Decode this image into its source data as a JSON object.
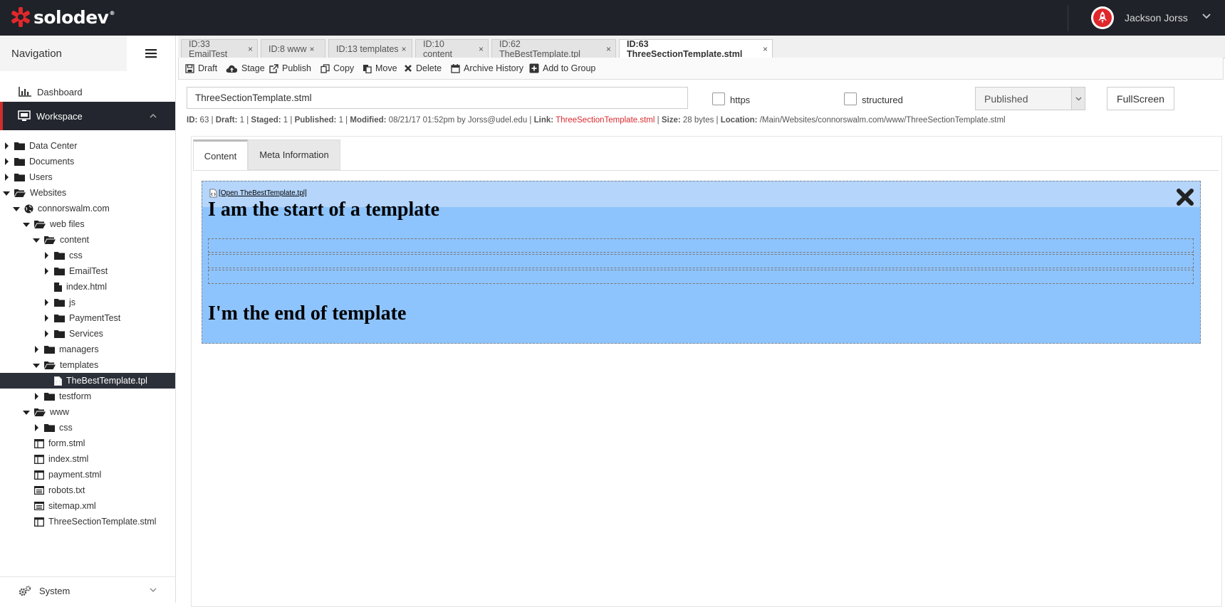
{
  "app": {
    "brand": "solodev",
    "brand_color": "#e0282c"
  },
  "user": {
    "name": "Jackson Jorss"
  },
  "sidebar": {
    "title": "Navigation",
    "dashboard": "Dashboard",
    "workspace": "Workspace",
    "system": "System",
    "tree": [
      {
        "label": "Data Center",
        "type": "folder",
        "expanded": false
      },
      {
        "label": "Documents",
        "type": "folder",
        "expanded": false
      },
      {
        "label": "Users",
        "type": "folder",
        "expanded": false
      },
      {
        "label": "Websites",
        "type": "folder",
        "expanded": true
      },
      {
        "label": "connorswalm.com",
        "type": "globe",
        "expanded": true
      },
      {
        "label": "web files",
        "type": "folder",
        "expanded": true
      },
      {
        "label": "content",
        "type": "folder",
        "expanded": true
      },
      {
        "label": "css",
        "type": "folder",
        "expanded": false
      },
      {
        "label": "EmailTest",
        "type": "folder",
        "expanded": false
      },
      {
        "label": "index.html",
        "type": "file"
      },
      {
        "label": "js",
        "type": "folder",
        "expanded": false
      },
      {
        "label": "PaymentTest",
        "type": "folder",
        "expanded": false
      },
      {
        "label": "Services",
        "type": "folder",
        "expanded": false
      },
      {
        "label": "managers",
        "type": "folder",
        "expanded": false
      },
      {
        "label": "templates",
        "type": "folder",
        "expanded": true
      },
      {
        "label": "TheBestTemplate.tpl",
        "type": "template",
        "selected": true
      },
      {
        "label": "testform",
        "type": "folder",
        "expanded": false
      },
      {
        "label": "www",
        "type": "folder",
        "expanded": true
      },
      {
        "label": "css",
        "type": "folder",
        "expanded": false
      },
      {
        "label": "form.stml",
        "type": "stml"
      },
      {
        "label": "index.stml",
        "type": "stml"
      },
      {
        "label": "payment.stml",
        "type": "stml"
      },
      {
        "label": "robots.txt",
        "type": "text"
      },
      {
        "label": "sitemap.xml",
        "type": "text"
      },
      {
        "label": "ThreeSectionTemplate.stml",
        "type": "stml"
      }
    ]
  },
  "file_tabs": [
    {
      "label": "ID:33 EmailTest",
      "active": false
    },
    {
      "label": "ID:8 www",
      "active": false
    },
    {
      "label": "ID:13 templates",
      "active": false
    },
    {
      "label": "ID:10 content",
      "active": false
    },
    {
      "label": "ID:62 TheBestTemplate.tpl",
      "active": false
    },
    {
      "label": "ID:63 ThreeSectionTemplate.stml",
      "active": true
    }
  ],
  "toolbar": {
    "draft": "Draft",
    "stage": "Stage",
    "publish": "Publish",
    "copy": "Copy",
    "move": "Move",
    "delete": "Delete",
    "archive": "Archive History",
    "add_group": "Add to Group"
  },
  "editor": {
    "filename": "ThreeSectionTemplate.stml",
    "https_label": "https",
    "structured_label": "structured",
    "status": "Published",
    "fullscreen": "FullScreen"
  },
  "meta": {
    "id_label": "ID:",
    "id": "63",
    "draft_label": "Draft:",
    "draft": "1",
    "staged_label": "Staged:",
    "staged": "1",
    "published_label": "Published:",
    "published": "1",
    "modified_label": "Modified:",
    "modified": "08/21/17 01:52pm",
    "by": "by Jorss@udel.edu",
    "link_label": "Link:",
    "link": "ThreeSectionTemplate.stml",
    "size_label": "Size:",
    "size": "28 bytes",
    "location_label": "Location:",
    "location": "/Main/Websites/connorswalm.com/www/ThreeSectionTemplate.stml"
  },
  "content_tabs": {
    "content": "Content",
    "meta": "Meta Information"
  },
  "template": {
    "open_link": "[Open TheBestTemplate.tpl]",
    "start_text": "I am the start of a template",
    "end_text": "I'm the end of template"
  }
}
